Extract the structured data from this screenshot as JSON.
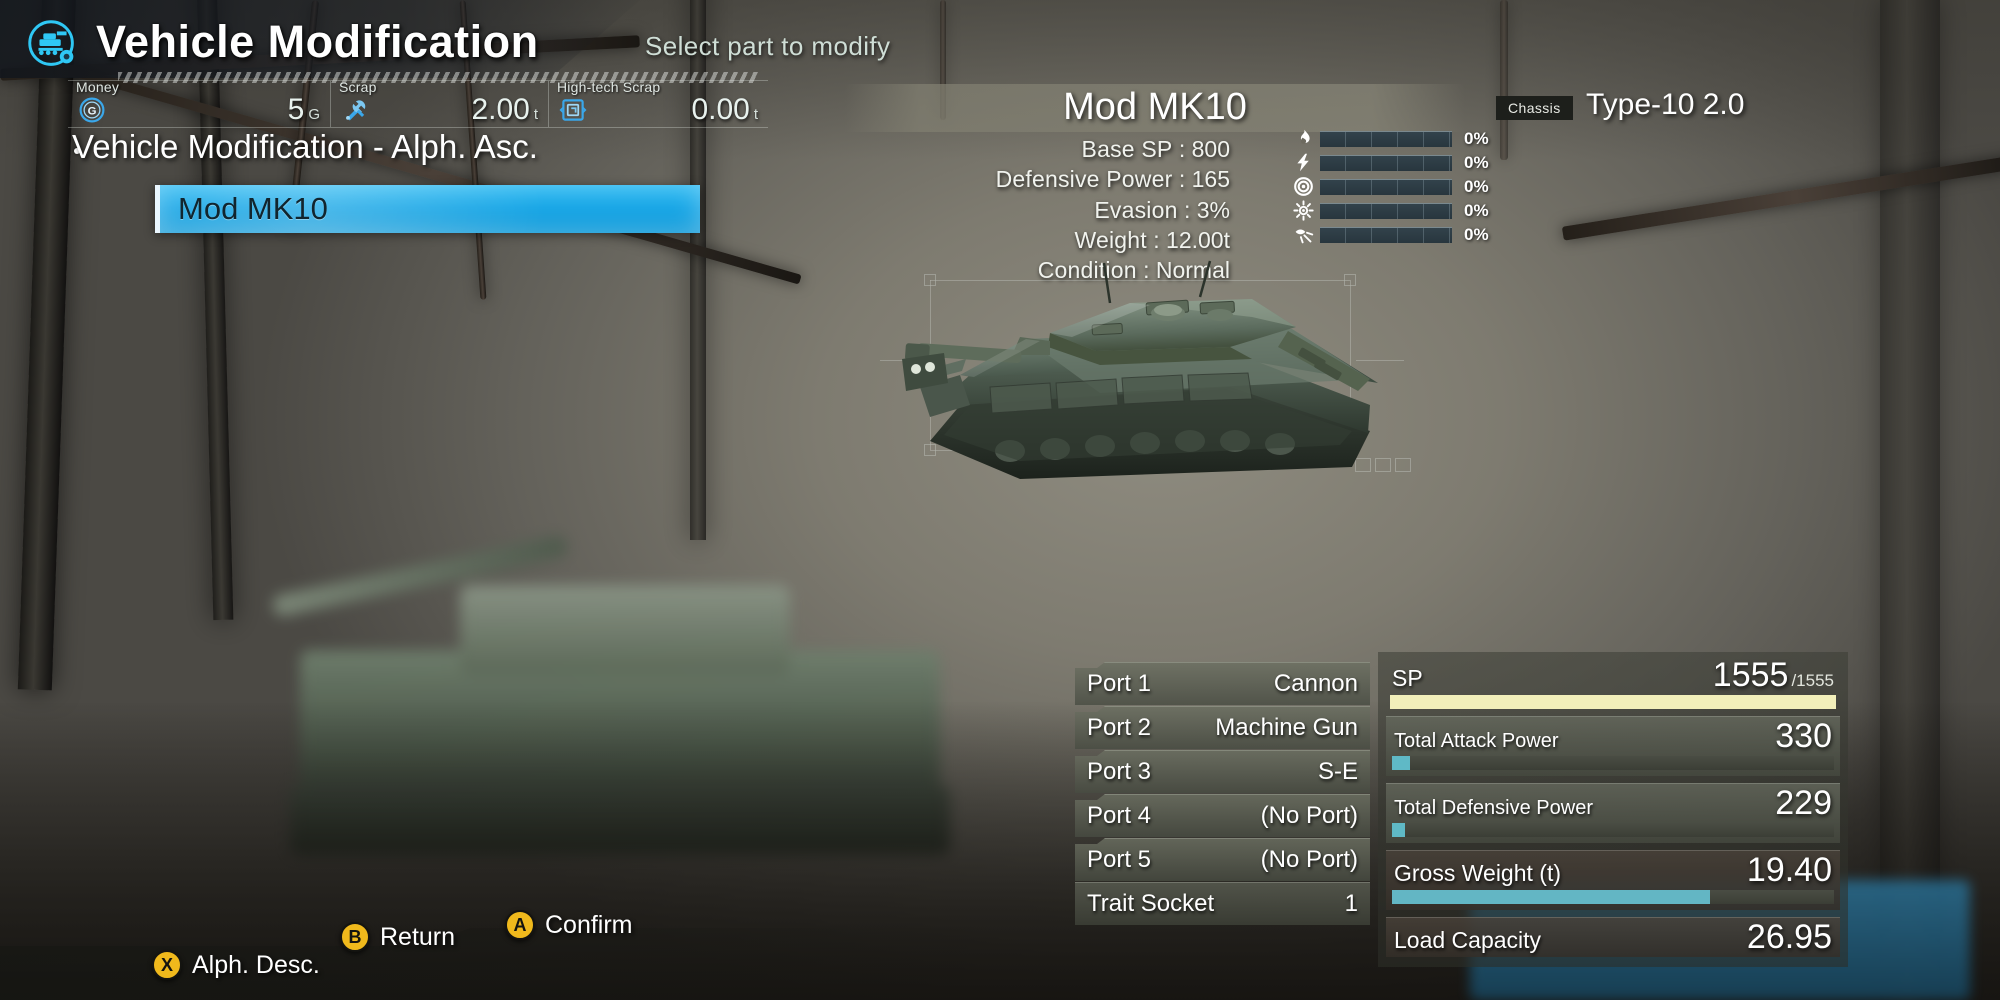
{
  "header": {
    "logo_icon": "tank-gear-hex-icon",
    "title": "Vehicle Modification",
    "subtitle": "Select part to modify"
  },
  "resources": [
    {
      "label": "Money",
      "icon": "money-g-icon",
      "value": "5",
      "unit": "G"
    },
    {
      "label": "Scrap",
      "icon": "wrench-scrap-icon",
      "value": "2.00",
      "unit": "t"
    },
    {
      "label": "High-tech Scrap",
      "icon": "high-tech-scrap-icon",
      "value": "0.00",
      "unit": "t"
    }
  ],
  "category": {
    "title": "Vehicle Modification - Alph. Asc."
  },
  "mod_list": {
    "items": [
      {
        "name": "Mod MK10",
        "selected": true
      }
    ]
  },
  "part": {
    "name": "Mod MK10",
    "chassis_label": "Chassis",
    "chassis_value": "Type-10 2.0",
    "stats": [
      {
        "key": "Base SP",
        "value": "800"
      },
      {
        "key": "Defensive Power",
        "value": "165"
      },
      {
        "key": "Evasion",
        "value": "3%"
      },
      {
        "key": "Weight",
        "value": "12.00t"
      },
      {
        "key": "Condition",
        "value": "Normal"
      }
    ]
  },
  "resistances": [
    {
      "icon": "flame-icon",
      "value": "0%",
      "pct": 0
    },
    {
      "icon": "lightning-icon",
      "value": "0%",
      "pct": 0
    },
    {
      "icon": "target-icon",
      "value": "0%",
      "pct": 0
    },
    {
      "icon": "biohazard-icon",
      "value": "0%",
      "pct": 0
    },
    {
      "icon": "shock-burst-icon",
      "value": "0%",
      "pct": 0
    }
  ],
  "ports": [
    {
      "key": "Port 1",
      "value": "Cannon"
    },
    {
      "key": "Port 2",
      "value": "Machine Gun"
    },
    {
      "key": "Port 3",
      "value": "S-E"
    },
    {
      "key": "Port 4",
      "value": "(No Port)"
    },
    {
      "key": "Port 5",
      "value": "(No Port)"
    },
    {
      "key": "Trait Socket",
      "value": "1"
    }
  ],
  "summary": {
    "sp": {
      "label": "SP",
      "value": "1555",
      "max": "1555",
      "pct": 100,
      "color": "#f2efba"
    },
    "attack": {
      "label": "Total Attack Power",
      "value": "330",
      "pct": 4,
      "color": "#5fb9c6"
    },
    "defense": {
      "label": "Total Defensive Power",
      "value": "229",
      "pct": 3,
      "color": "#5fb9c6"
    },
    "weight": {
      "label": "Gross Weight (t)",
      "value": "19.40",
      "pct": 72,
      "color": "#63b6c4"
    },
    "load": {
      "label": "Load Capacity",
      "value": "26.95"
    }
  },
  "footer": {
    "prompts": [
      {
        "button": "X",
        "label": "Alph. Desc."
      },
      {
        "button": "B",
        "label": "Return"
      },
      {
        "button": "A",
        "label": "Confirm"
      }
    ]
  },
  "colors": {
    "selection": "#18a6e6",
    "prompt_button": "#f0b91c",
    "sp_bar": "#f2efba",
    "stat_bar": "#5fb9c6"
  }
}
